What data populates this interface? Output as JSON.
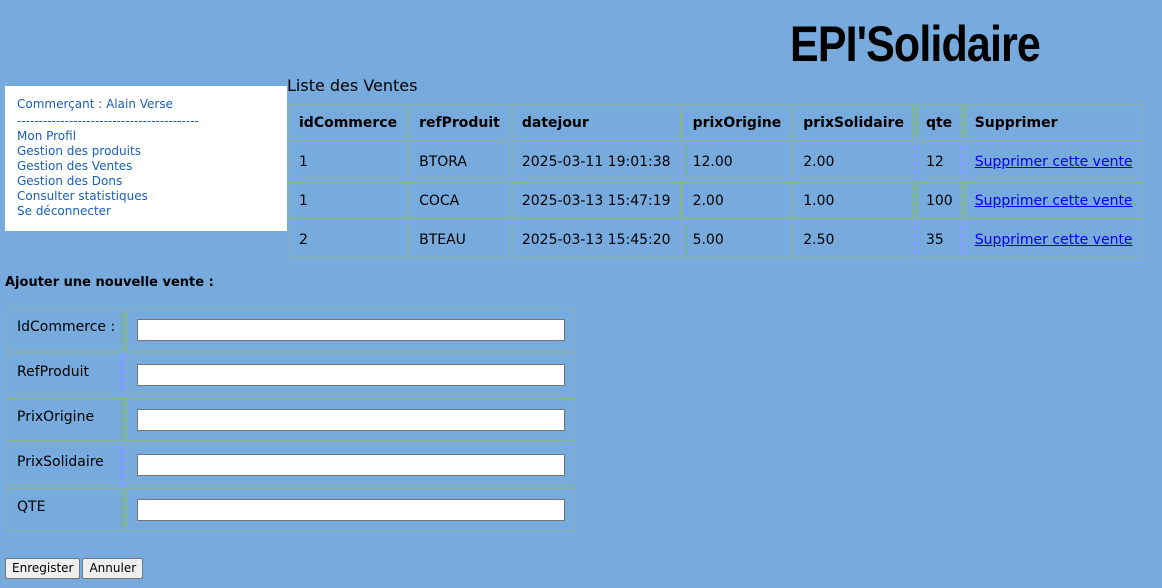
{
  "header": {
    "logo": "EPI'Solidaire"
  },
  "menu": {
    "user": "Commerçant : Alain Verse",
    "separator": "------------------------------------------",
    "items": [
      {
        "label": "Mon Profil"
      },
      {
        "label": "Gestion des produits"
      },
      {
        "label": "Gestion des Ventes"
      },
      {
        "label": "Gestion des Dons"
      },
      {
        "label": "Consulter statistiques"
      },
      {
        "label": "Se déconnecter"
      }
    ]
  },
  "sales": {
    "title": "Liste des Ventes",
    "columns": [
      "idCommerce",
      "refProduit",
      "datejour",
      "prixOrigine",
      "prixSolidaire",
      "qte",
      "Supprimer"
    ],
    "rows": [
      {
        "idCommerce": "1",
        "refProduit": "BTORA",
        "datejour": "2025-03-11 19:01:38",
        "prixOrigine": "12.00",
        "prixSolidaire": "2.00",
        "qte": "12",
        "action": "Supprimer cette vente"
      },
      {
        "idCommerce": "1",
        "refProduit": "COCA",
        "datejour": "2025-03-13 15:47:19",
        "prixOrigine": "2.00",
        "prixSolidaire": "1.00",
        "qte": "100",
        "action": "Supprimer cette vente"
      },
      {
        "idCommerce": "2",
        "refProduit": "BTEAU",
        "datejour": "2025-03-13 15:45:20",
        "prixOrigine": "5.00",
        "prixSolidaire": "2.50",
        "qte": "35",
        "action": "Supprimer cette vente"
      }
    ]
  },
  "form": {
    "title": "Ajouter une nouvelle vente :",
    "fields": [
      {
        "label": "IdCommerce :",
        "value": ""
      },
      {
        "label": "RefProduit",
        "value": ""
      },
      {
        "label": "PrixOrigine",
        "value": ""
      },
      {
        "label": "PrixSolidaire",
        "value": ""
      },
      {
        "label": "QTE",
        "value": ""
      }
    ],
    "submit_label": "Enregister",
    "reset_label": "Annuler"
  },
  "colors": {
    "background": "#77aadd",
    "link": "#0000ee",
    "menu_link": "#1a5fb4"
  }
}
